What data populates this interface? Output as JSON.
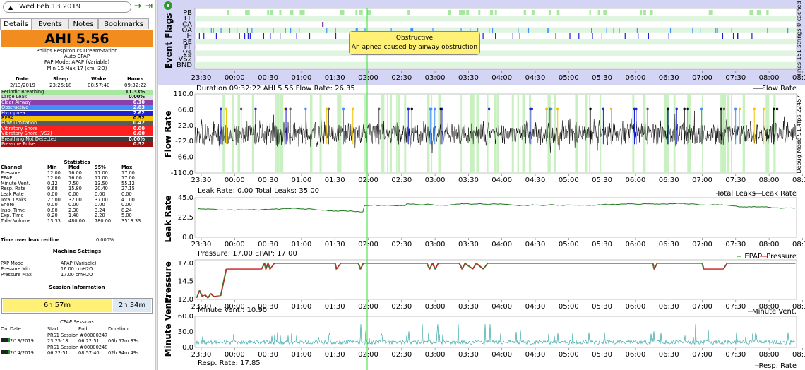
{
  "date": "Wed Feb 13 2019",
  "tabs": [
    "Details",
    "Events",
    "Notes",
    "Bookmarks"
  ],
  "ahi_text": "AHI 5.56",
  "machine": {
    "line1": "Philips Respironics DreamStation",
    "line2": "Auto CPAP",
    "line3": "PAP Mode: APAP (Variable)",
    "line4": "Min 16 Max 17 (cmH2O)"
  },
  "summary_head": {
    "date_label": "Date",
    "sleep_label": "Sleep",
    "wake_label": "Wake",
    "hours_label": "Hours",
    "date": "2/13/2019",
    "sleep": "23:25:18",
    "wake": "08:57:40",
    "hours": "09:32:22"
  },
  "events": [
    {
      "name": "Periodic Breathing",
      "value": "11.33%",
      "color": "#a8e7a0"
    },
    {
      "name": "Large Leak",
      "value": "0.00%",
      "color": "#e0e0e0"
    },
    {
      "name": "Clear Airway",
      "value": "0.10",
      "color": "#8b3fa8"
    },
    {
      "name": "Obstructive",
      "value": "2.83",
      "color": "#3f8fff"
    },
    {
      "name": "Hypopnea",
      "value": "2.62",
      "color": "#1f1fd6"
    },
    {
      "name": "RERA",
      "value": "0.52",
      "color": "#f5c400"
    },
    {
      "name": "Flow Limitation",
      "value": "0.42",
      "color": "#5a5a5a"
    },
    {
      "name": "Vibratory Snore",
      "value": "0.00",
      "color": "#ff2020"
    },
    {
      "name": "Vibratory Snore (VS2)",
      "value": "0.00",
      "color": "#ff2020"
    },
    {
      "name": "Breathing Not Detected",
      "value": "0.00%",
      "color": "#3a3a3a"
    },
    {
      "name": "Pressure Pulse",
      "value": "0.52",
      "color": "#a01010"
    }
  ],
  "statistics_title": "Statistics",
  "stats_headers": [
    "Channel",
    "Min",
    "Med",
    "95%",
    "Max"
  ],
  "stats": [
    [
      "Pressure",
      "12.00",
      "16.00",
      "17.00",
      "17.00"
    ],
    [
      "EPAP",
      "12.00",
      "16.00",
      "17.00",
      "17.00"
    ],
    [
      "Minute Vent.",
      "0.12",
      "7.50",
      "13.50",
      "55.12"
    ],
    [
      "Resp. Rate",
      "9.68",
      "15.80",
      "20.40",
      "27.15"
    ],
    [
      "Leak Rate",
      "0.00",
      "0.00",
      "0.00",
      "0.00"
    ],
    [
      "Total Leaks",
      "27.00",
      "32.00",
      "37.00",
      "41.00"
    ],
    [
      "Snore",
      "0.00",
      "0.00",
      "0.00",
      "0.00"
    ],
    [
      "Insp. Time",
      "0.80",
      "2.30",
      "3.24",
      "8.24"
    ],
    [
      "Exp. Time",
      "0.20",
      "1.40",
      "2.20",
      "5.00"
    ],
    [
      "Tidal Volume",
      "13.33",
      "480.00",
      "780.00",
      "3513.33"
    ]
  ],
  "leak_redline": {
    "label": "Time over leak redline",
    "value": "0.000%"
  },
  "machine_settings_title": "Machine Settings",
  "settings": [
    {
      "k": "PAP Mode",
      "v": "APAP (Variable)"
    },
    {
      "k": "Pressure Min",
      "v": "16.00 cmH2O"
    },
    {
      "k": "Pressure Max",
      "v": "17.00 cmH2O"
    }
  ],
  "session_info_title": "Session Information",
  "session_bar": {
    "a": "6h 57m",
    "b": "2h 34m"
  },
  "cpap_sessions": {
    "title": "CPAP Sessions",
    "headers": [
      "On",
      "Date",
      "Start",
      "End",
      "Duration"
    ],
    "rows": [
      {
        "label": "PRS1 Session #00000247",
        "date": "2/13/2019",
        "start": "23:25:18",
        "end": "06:22:51",
        "duration": "06h 57m 33s"
      },
      {
        "label": "PRS1 Session #00000248",
        "date": "2/14/2019",
        "start": "06:22:51",
        "end": "08:57:40",
        "duration": "02h 34m 49s"
      }
    ]
  },
  "time_ticks": [
    "23:30",
    "00:00",
    "00:30",
    "01:00",
    "01:30",
    "02:00",
    "02:30",
    "03:00",
    "03:30",
    "04:00",
    "04:30",
    "05:00",
    "05:30",
    "06:00",
    "06:30",
    "07:00",
    "07:30",
    "08:00",
    "08:30"
  ],
  "event_flags": {
    "title": "Event Flags",
    "rows": [
      "PB",
      "LL",
      "CA",
      "OA",
      "H",
      "RE",
      "FL",
      "VS",
      "VS2",
      "BND"
    ],
    "tooltip_title": "Obstructive",
    "tooltip_text": "An apnea caused by airway obstruction",
    "side_text": "lines 151 strings 0 cached"
  },
  "flow": {
    "title": "Flow Rate",
    "info": "Duration 09:32:22 AHI 5.56 Flow Rate: 26.35",
    "legend": "Flow Rate",
    "y_ticks": [
      "110.0",
      "66.0",
      "22.0",
      "-22.0",
      "-66.0",
      "-110.0"
    ],
    "side_text": "Debug Mode 91.4fps 22457"
  },
  "leak": {
    "title": "Leak Rate",
    "info": "Leak Rate: 0.00 Total Leaks: 35.00",
    "legend": [
      "Total Leaks",
      "Leak Rate"
    ],
    "y_ticks": [
      "45.0",
      "22.5",
      "0.0"
    ]
  },
  "pressure": {
    "title": "Pressure",
    "info": "Pressure: 17.00 EPAP: 17.00",
    "legend": [
      "EPAP",
      "Pressure"
    ],
    "y_ticks": [
      "17.0",
      "14.5",
      "12.0"
    ]
  },
  "minvent": {
    "title": "Minute Vent.",
    "info": "Minute Vent.: 10.90",
    "legend": "Minute Vent.",
    "y_ticks": [
      "60.0",
      "30.0",
      "0.0"
    ]
  },
  "resp": {
    "info": "Resp. Rate: 17.85",
    "legend": "Resp. Rate"
  },
  "colors": {
    "pb": "#a8e7a0",
    "oa": "#3f8fff",
    "h": "#1f1fd6",
    "ca": "#8b3fa8",
    "re": "#f5c400",
    "fl": "#5a5a5a",
    "leak": "#1b7a1b",
    "epap": "#1b7a1b",
    "pressure": "#c81e1e",
    "minvent": "#1a9a9a",
    "cursor": "#33dd33"
  }
}
